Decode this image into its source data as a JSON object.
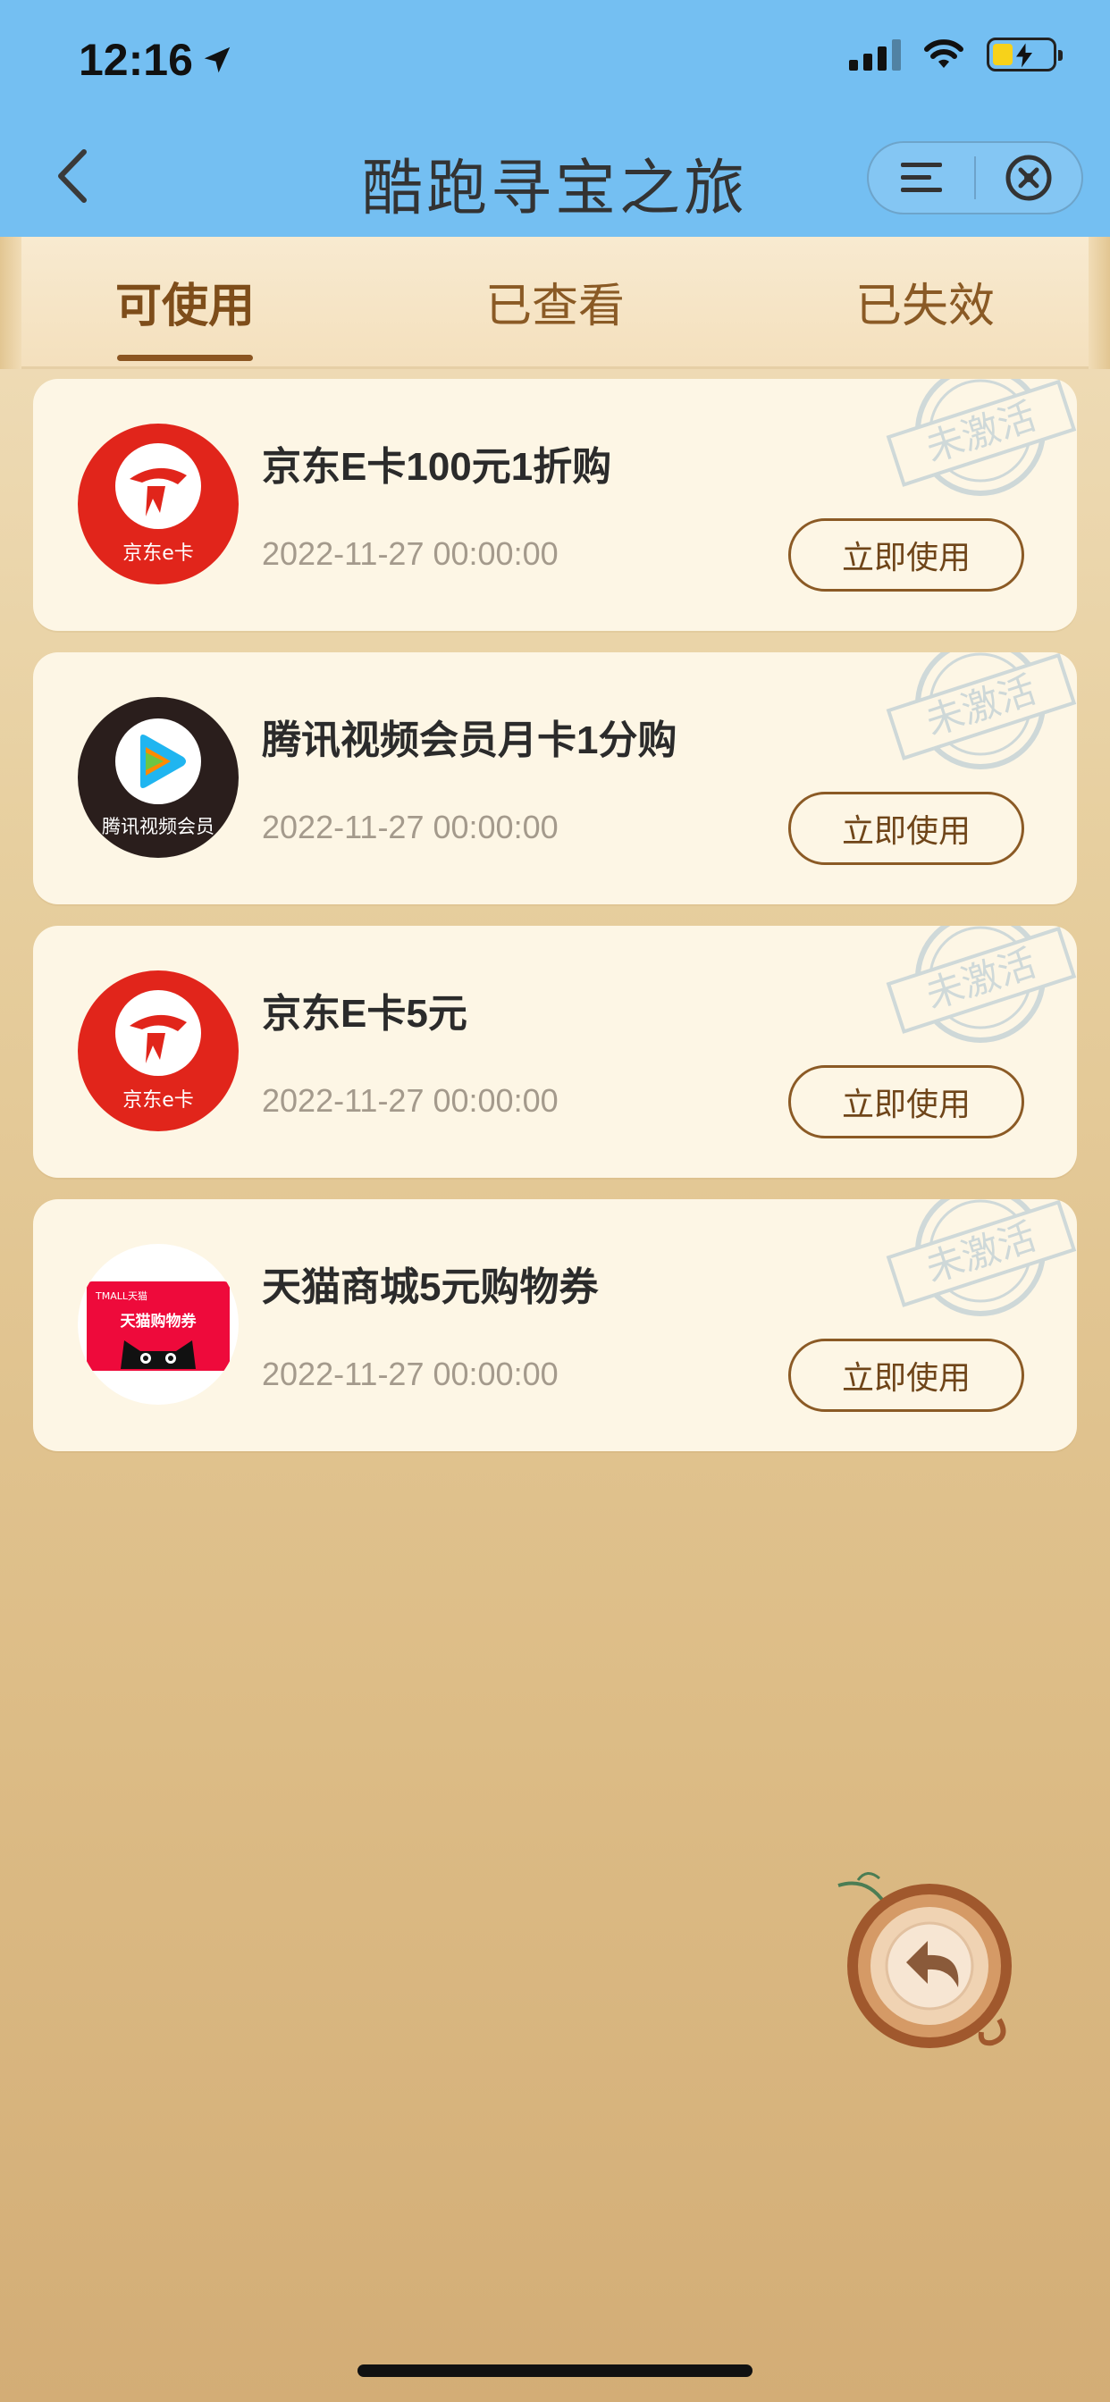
{
  "status_bar": {
    "time": "12:16"
  },
  "header": {
    "title": "酷跑寻宝之旅"
  },
  "tabs": [
    {
      "label": "可使用",
      "active": true
    },
    {
      "label": "已查看",
      "active": false
    },
    {
      "label": "已失效",
      "active": false
    }
  ],
  "stamp_text": "未激活",
  "cards": [
    {
      "title": "京东E卡100元1折购",
      "date": "2022-11-27 00:00:00",
      "button": "立即使用",
      "logo_caption": "京东e卡",
      "logo_icon": "jd-ecard-icon"
    },
    {
      "title": "腾讯视频会员月卡1分购",
      "date": "2022-11-27 00:00:00",
      "button": "立即使用",
      "logo_caption": "腾讯视频会员",
      "logo_icon": "tencent-video-icon"
    },
    {
      "title": "京东E卡5元",
      "date": "2022-11-27 00:00:00",
      "button": "立即使用",
      "logo_caption": "京东e卡",
      "logo_icon": "jd-ecard-icon"
    },
    {
      "title": "天猫商城5元购物券",
      "date": "2022-11-27 00:00:00",
      "button": "立即使用",
      "logo_caption": "天猫购物券",
      "logo_brand": "TMALL天猫",
      "logo_icon": "tmall-coupon-icon"
    }
  ],
  "colors": {
    "header_bg": "#74bff2",
    "accent": "#8b5521",
    "card_bg": "#fdf6e5"
  }
}
